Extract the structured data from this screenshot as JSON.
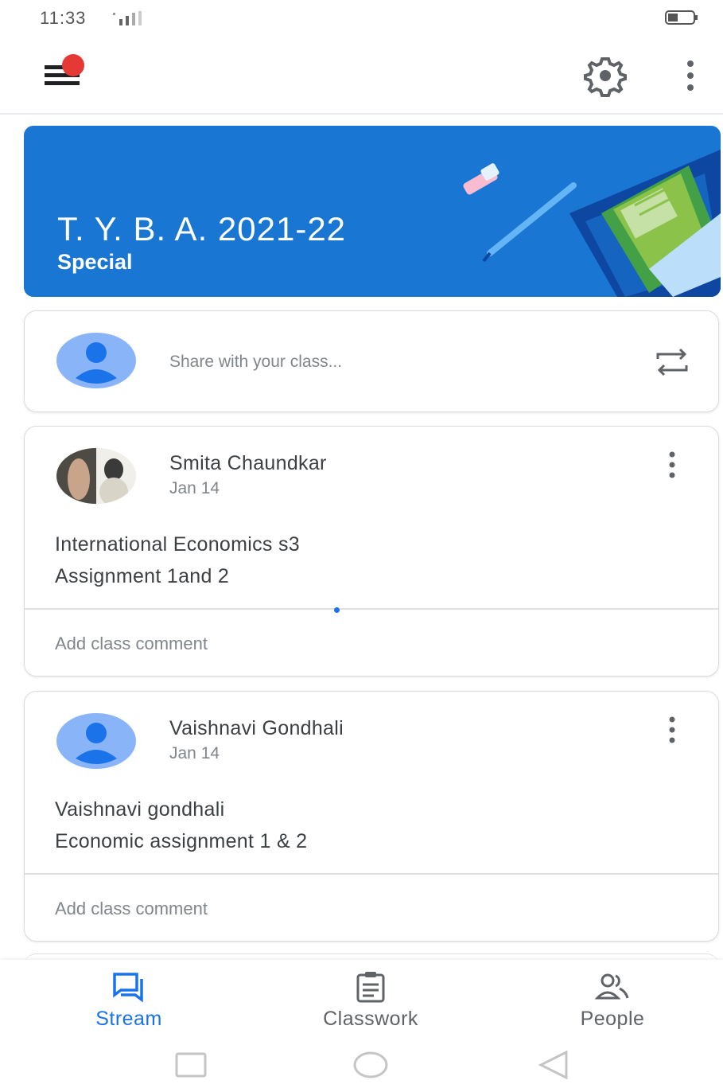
{
  "status_bar": {
    "time": "11:33"
  },
  "app_bar": {
    "menu_icon": "menu-icon-with-notification-dot",
    "settings_icon": "gear-icon",
    "more_icon": "more-vert-icon"
  },
  "banner": {
    "title": "T. Y. B. A.  2021-22",
    "subtitle": "Special",
    "color": "#1976d2"
  },
  "share": {
    "placeholder": "Share with your class..."
  },
  "posts": [
    {
      "author": "Smita Chaundkar",
      "date": "Jan 14",
      "lines": [
        "International Economics s3",
        "Assignment 1and 2"
      ],
      "comment": "Add class comment"
    },
    {
      "author": "Vaishnavi Gondhali",
      "date": "Jan 14",
      "lines": [
        "Vaishnavi gondhali",
        "Economic assignment 1 & 2"
      ],
      "comment": "Add class comment"
    }
  ],
  "bottom_nav": {
    "items": [
      {
        "label": "Stream",
        "icon": "stream-icon",
        "active": true
      },
      {
        "label": "Classwork",
        "icon": "classwork-icon",
        "active": false
      },
      {
        "label": "People",
        "icon": "people-icon",
        "active": false
      }
    ],
    "accent": "#1a73e8"
  },
  "system_nav": {
    "buttons": [
      "recents",
      "home",
      "back"
    ]
  }
}
